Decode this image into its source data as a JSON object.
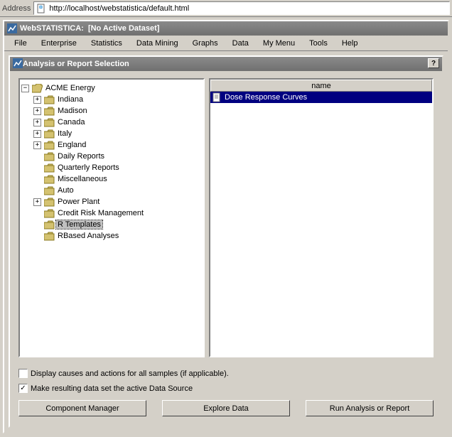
{
  "address_bar": {
    "label": "Address",
    "url": "http://localhost/webstatistica/default.html"
  },
  "app": {
    "title": "WebSTATISTICA:  [No Active Dataset]"
  },
  "menu": {
    "items": [
      "File",
      "Enterprise",
      "Statistics",
      "Data Mining",
      "Graphs",
      "Data",
      "My Menu",
      "Tools",
      "Help"
    ]
  },
  "dialog": {
    "title": "Analysis or Report Selection",
    "help": "?"
  },
  "tree": {
    "root": {
      "label": "ACME Energy",
      "expanded": true,
      "children": [
        {
          "label": "Indiana",
          "expandable": true
        },
        {
          "label": "Madison",
          "expandable": true
        },
        {
          "label": "Canada",
          "expandable": true
        },
        {
          "label": "Italy",
          "expandable": true
        },
        {
          "label": "England",
          "expandable": true
        },
        {
          "label": "Daily Reports",
          "expandable": false
        },
        {
          "label": "Quarterly Reports",
          "expandable": false
        },
        {
          "label": "Miscellaneous",
          "expandable": false
        },
        {
          "label": "Auto",
          "expandable": false
        },
        {
          "label": "Power Plant",
          "expandable": true
        },
        {
          "label": "Credit Risk Management",
          "expandable": false
        },
        {
          "label": "R Templates",
          "expandable": false,
          "selected": true
        },
        {
          "label": "RBased Analyses",
          "expandable": false
        }
      ]
    }
  },
  "list": {
    "header": "name",
    "items": [
      {
        "label": "Dose Response Curves",
        "selected": true
      }
    ]
  },
  "options": {
    "display_causes": {
      "checked": false,
      "label": "Display causes and actions for all samples (if applicable)."
    },
    "make_active": {
      "checked": true,
      "label": "Make resulting data set the active Data Source"
    }
  },
  "buttons": {
    "component_manager": "Component Manager",
    "explore_data": "Explore Data",
    "run": "Run Analysis or Report"
  }
}
